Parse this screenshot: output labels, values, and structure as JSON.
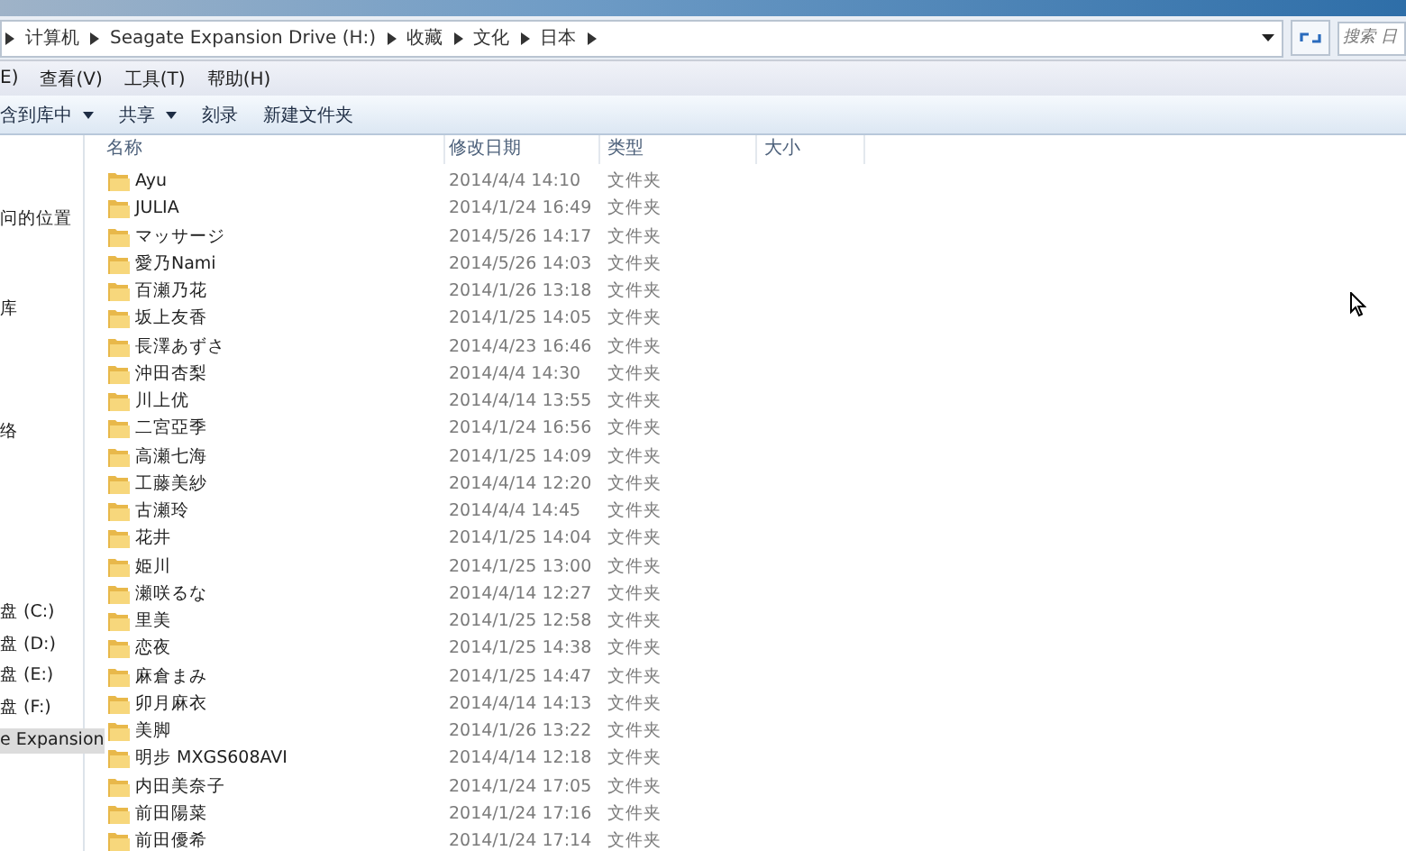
{
  "address_bar": {
    "path": [
      "计算机",
      "Seagate Expansion Drive (H:)",
      "收藏",
      "文化",
      "日本"
    ]
  },
  "search": {
    "placeholder": "搜索 日"
  },
  "menu": [
    "E)",
    "查看(V)",
    "工具(T)",
    "帮助(H)"
  ],
  "toolbar": [
    {
      "label": "含到库中",
      "dropdown": true
    },
    {
      "label": "共享",
      "dropdown": true
    },
    {
      "label": "刻录",
      "dropdown": false
    },
    {
      "label": "新建文件夹",
      "dropdown": false
    }
  ],
  "sidebar": {
    "items": [
      {
        "label": "问的位置",
        "selected": false
      },
      {
        "label": "库",
        "selected": false
      },
      {
        "label": "络",
        "selected": false
      },
      {
        "label": "盘 (C:)",
        "selected": false
      },
      {
        "label": "盘 (D:)",
        "selected": false
      },
      {
        "label": "盘 (E:)",
        "selected": false
      },
      {
        "label": "盘 (F:)",
        "selected": false
      },
      {
        "label": "e Expansion",
        "selected": true
      }
    ]
  },
  "table": {
    "columns": [
      "名称",
      "修改日期",
      "类型",
      "大小"
    ],
    "rows": [
      {
        "name": "Ayu",
        "modified": "2014/4/4 14:10",
        "type": "文件夹"
      },
      {
        "name": "JULIA",
        "modified": "2014/1/24 16:49",
        "type": "文件夹"
      },
      {
        "name": "マッサージ",
        "modified": "2014/5/26 14:17",
        "type": "文件夹"
      },
      {
        "name": "愛乃Nami",
        "modified": "2014/5/26 14:03",
        "type": "文件夹"
      },
      {
        "name": "百瀬乃花",
        "modified": "2014/1/26 13:18",
        "type": "文件夹"
      },
      {
        "name": "坂上友香",
        "modified": "2014/1/25 14:05",
        "type": "文件夹"
      },
      {
        "name": "長澤あずさ",
        "modified": "2014/4/23 16:46",
        "type": "文件夹"
      },
      {
        "name": "沖田杏梨",
        "modified": "2014/4/4 14:30",
        "type": "文件夹"
      },
      {
        "name": "川上优",
        "modified": "2014/4/14 13:55",
        "type": "文件夹"
      },
      {
        "name": "二宮亞季",
        "modified": "2014/1/24 16:56",
        "type": "文件夹"
      },
      {
        "name": "高瀬七海",
        "modified": "2014/1/25 14:09",
        "type": "文件夹"
      },
      {
        "name": "工藤美紗",
        "modified": "2014/4/14 12:20",
        "type": "文件夹"
      },
      {
        "name": "古瀬玲",
        "modified": "2014/4/4 14:45",
        "type": "文件夹"
      },
      {
        "name": "花井",
        "modified": "2014/1/25 14:04",
        "type": "文件夹"
      },
      {
        "name": "姫川",
        "modified": "2014/1/25 13:00",
        "type": "文件夹"
      },
      {
        "name": "瀬咲るな",
        "modified": "2014/4/14 12:27",
        "type": "文件夹"
      },
      {
        "name": "里美",
        "modified": "2014/1/25 12:58",
        "type": "文件夹"
      },
      {
        "name": "恋夜",
        "modified": "2014/1/25 14:38",
        "type": "文件夹"
      },
      {
        "name": "麻倉まみ",
        "modified": "2014/1/25 14:47",
        "type": "文件夹"
      },
      {
        "name": "卯月麻衣",
        "modified": "2014/4/14 14:13",
        "type": "文件夹"
      },
      {
        "name": "美脚",
        "modified": "2014/1/26 13:22",
        "type": "文件夹"
      },
      {
        "name": "明步 MXGS608AVI",
        "modified": "2014/4/14 12:18",
        "type": "文件夹"
      },
      {
        "name": "内田美奈子",
        "modified": "2014/1/24 17:05",
        "type": "文件夹"
      },
      {
        "name": "前田陽菜",
        "modified": "2014/1/24 17:16",
        "type": "文件夹"
      },
      {
        "name": "前田優希",
        "modified": "2014/1/24 17:14",
        "type": "文件夹"
      }
    ]
  }
}
